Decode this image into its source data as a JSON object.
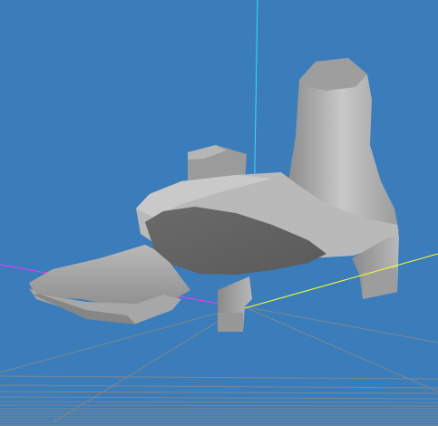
{
  "viewport": {
    "background_color": "#3a7dba"
  },
  "axes": {
    "x_axis_color": "#ffff33",
    "y_axis_color": "#33ddff",
    "z_axis_color": "#ff33ff"
  },
  "ground_grid": {
    "line_color": "#7f8790"
  },
  "model": {
    "name": "shoe-model",
    "shade_light": "#c7c7c7",
    "shade_mid": "#9a9a9a",
    "shade_dark": "#6a6a6a"
  }
}
